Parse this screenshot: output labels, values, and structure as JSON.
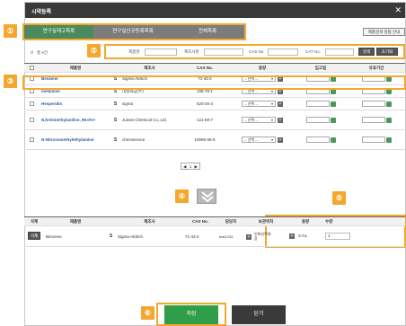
{
  "dialog": {
    "title": "시약등록",
    "close_icon": "close-icon"
  },
  "callouts": [
    "①",
    "②",
    "③",
    "④",
    "⑤",
    "⑥"
  ],
  "tabs": [
    {
      "label": "연구실재고목록",
      "active": true
    },
    {
      "label": "연구실신규등록목록",
      "active": false
    },
    {
      "label": "전체목록",
      "active": false
    }
  ],
  "guide_button": "제품검색 방법 안내",
  "search": {
    "count_icon": "search-icon",
    "count_text": "총 5건",
    "product_label": "제품명",
    "maker_label": "제조사명",
    "cas_label": "CAS No.",
    "cat_label": "CAT No.",
    "search_button": "검색",
    "reset_button": "초기화"
  },
  "results": {
    "headers": [
      "",
      "제품명",
      "",
      "제조사",
      "CAS No.",
      "용량",
      "입고일",
      "유효기간"
    ],
    "select_placeholder": "-- 선택 --",
    "rows": [
      {
        "name": "Benzene",
        "maker": "Sigma-Aldrich",
        "cas": "71-43-2",
        "highlight": true
      },
      {
        "name": "melamine",
        "maker": "대정화금(주)",
        "cas": "108-78-1",
        "highlight": false
      },
      {
        "name": "Hesperidin",
        "maker": "sigma",
        "cas": "520-26-3",
        "highlight": false
      },
      {
        "name": "N,N-Dimethylaniline, 99.0%+",
        "maker": "Junsei Chemical Co.,Ltd.",
        "cas": "121-69-7",
        "highlight": false
      },
      {
        "name": "N-Nitrosomethylethylamine",
        "maker": "chemservice",
        "cas": "10595-95-6",
        "highlight": false
      }
    ],
    "s_icon": "S",
    "pager": {
      "prev": "◀",
      "page": "1",
      "next": "▶"
    }
  },
  "move_down_icon": "double-chevron-down-icon",
  "selected": {
    "headers": [
      "삭제",
      "제품명",
      "",
      "제조사",
      "CAS No.",
      "담당자",
      "보관위치",
      "용량",
      "수량"
    ],
    "rows": [
      {
        "delete_label": "삭제",
        "name": "Benzene",
        "maker": "Sigma-Aldrich",
        "cas": "71-43-2",
        "manager": "test1234",
        "location": "인화성액체장",
        "capacity": "5 mL",
        "quantity": "1"
      }
    ]
  },
  "footer": {
    "save_label": "저장",
    "close_label": "닫기"
  },
  "colors": {
    "accent": "#f4a72d",
    "tab_active": "#4a8a5e",
    "title_bar": "#3a3a3a",
    "link": "#2c5aa0",
    "save": "#2e9e4a",
    "close": "#3a3a3a"
  }
}
